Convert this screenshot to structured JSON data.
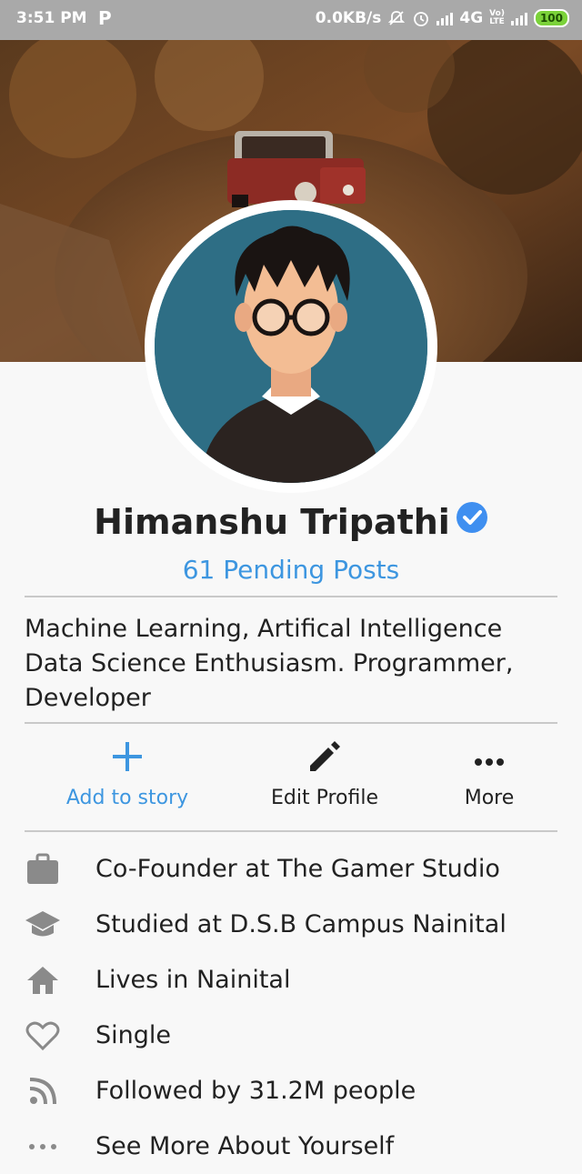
{
  "status_bar": {
    "time": "3:51 PM",
    "app_icon": "P",
    "network_speed": "0.0KB/s",
    "network_type": "4G",
    "volte": "VoLTE",
    "battery": "100"
  },
  "profile": {
    "name": "Himanshu Tripathi",
    "verified": true,
    "pending_posts": "61 Pending Posts",
    "bio": "Machine Learning, Artifical Intelligence Data Science Enthusiasm. Programmer, Developer"
  },
  "actions": [
    {
      "label": "Add to story",
      "icon": "plus-icon"
    },
    {
      "label": "Edit Profile",
      "icon": "pencil-icon"
    },
    {
      "label": "More",
      "icon": "more-icon"
    }
  ],
  "info": [
    {
      "icon": "briefcase-icon",
      "text": "Co-Founder at The Gamer Studio"
    },
    {
      "icon": "school-icon",
      "text": "Studied at D.S.B Campus Nainital"
    },
    {
      "icon": "home-icon",
      "text": "Lives in Nainital"
    },
    {
      "icon": "heart-icon",
      "text": "Single"
    },
    {
      "icon": "rss-icon",
      "text": "Followed by 31.2M people"
    },
    {
      "icon": "more-horiz-icon",
      "text": "See More About Yourself"
    }
  ],
  "colors": {
    "accent": "#3d96e0",
    "verified": "#3f8ff0",
    "icon_gray": "#8a8a8a",
    "status_bar": "#a9a9a9"
  }
}
